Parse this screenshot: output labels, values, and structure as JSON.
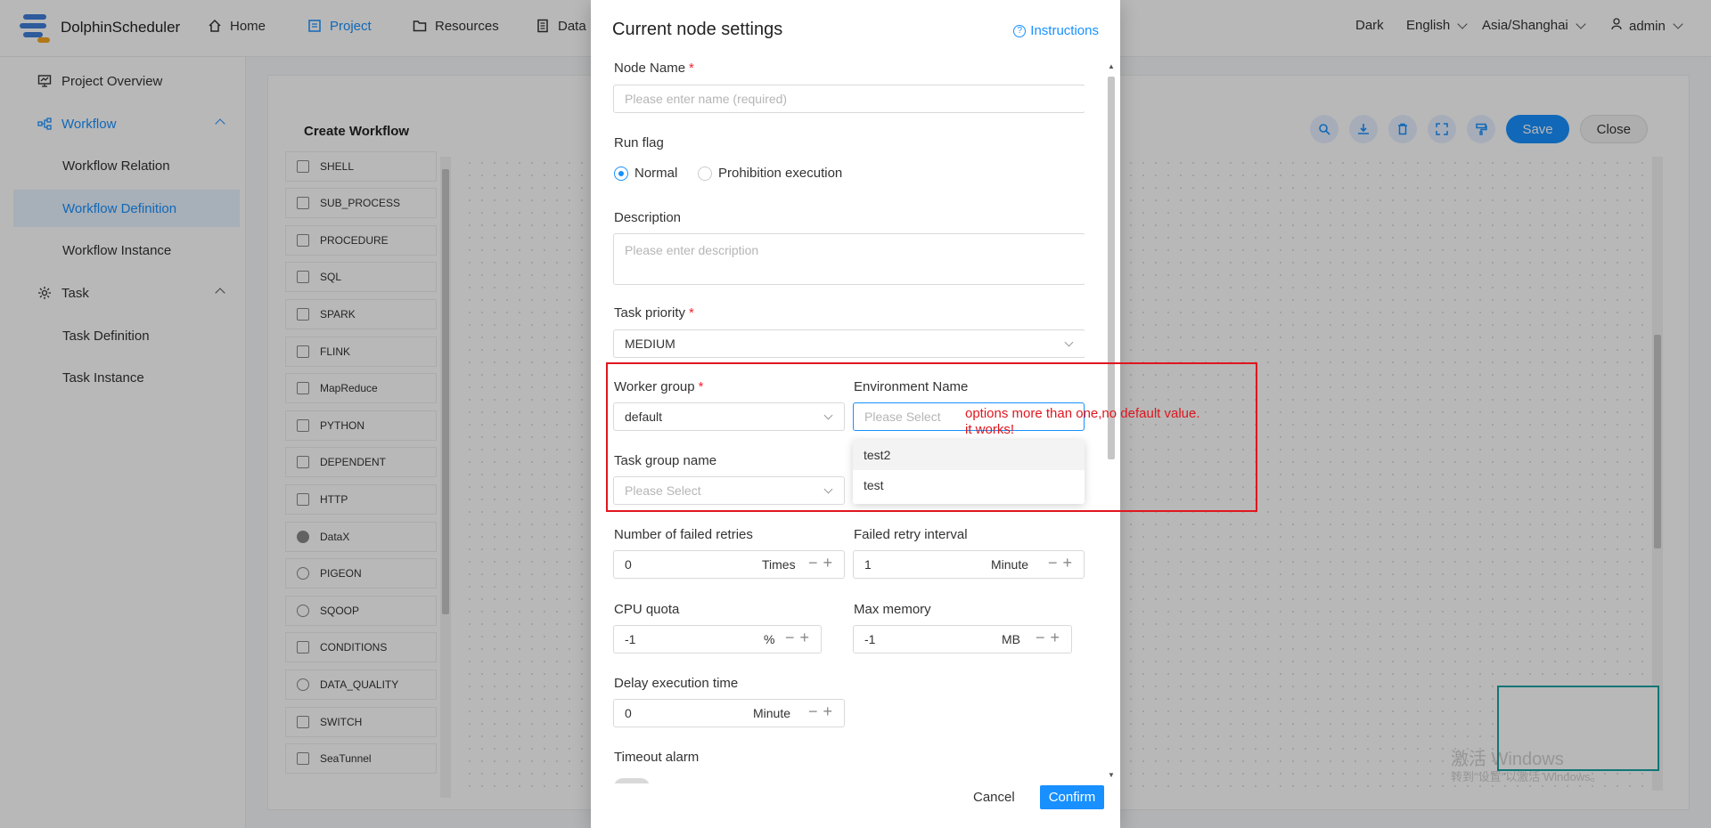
{
  "app": {
    "brand": "DolphinScheduler",
    "nav": [
      {
        "label": "Home",
        "icon": "home-icon"
      },
      {
        "label": "Project",
        "icon": "project-icon"
      },
      {
        "label": "Resources",
        "icon": "folder-icon"
      },
      {
        "label": "Data",
        "icon": "datasource-icon"
      }
    ],
    "theme_label": "Dark",
    "language_label": "English",
    "timezone_label": "Asia/Shanghai",
    "user_label": "admin"
  },
  "sidebar": {
    "items": [
      {
        "label": "Project Overview"
      },
      {
        "label": "Workflow"
      },
      {
        "label": "Workflow Relation"
      },
      {
        "label": "Workflow Definition"
      },
      {
        "label": "Workflow Instance"
      },
      {
        "label": "Task"
      },
      {
        "label": "Task Definition"
      },
      {
        "label": "Task Instance"
      }
    ]
  },
  "workflow": {
    "title": "Create Workflow",
    "save_label": "Save",
    "close_label": "Close",
    "tasks": [
      "SHELL",
      "SUB_PROCESS",
      "PROCEDURE",
      "SQL",
      "SPARK",
      "FLINK",
      "MapReduce",
      "PYTHON",
      "DEPENDENT",
      "HTTP",
      "DataX",
      "PIGEON",
      "SQOOP",
      "CONDITIONS",
      "DATA_QUALITY",
      "SWITCH",
      "SeaTunnel"
    ]
  },
  "modal": {
    "title": "Current node settings",
    "instructions_label": "Instructions",
    "node_name_label": "Node Name",
    "node_name_placeholder": "Please enter name (required)",
    "run_flag_label": "Run flag",
    "run_flag_normal": "Normal",
    "run_flag_prohibition": "Prohibition execution",
    "description_label": "Description",
    "description_placeholder": "Please enter description",
    "priority_label": "Task priority",
    "priority_value": "MEDIUM",
    "worker_group_label": "Worker group",
    "worker_group_value": "default",
    "environment_label": "Environment Name",
    "environment_placeholder": "Please Select",
    "task_group_label": "Task group name",
    "task_group_placeholder": "Please Select",
    "retries_label": "Number of failed retries",
    "retries_value": "0",
    "retries_unit": "Times",
    "retry_interval_label": "Failed retry interval",
    "retry_interval_value": "1",
    "retry_interval_unit": "Minute",
    "cpu_label": "CPU quota",
    "cpu_value": "-1",
    "cpu_unit": "%",
    "memory_label": "Max memory",
    "memory_value": "-1",
    "memory_unit": "MB",
    "delay_label": "Delay execution time",
    "delay_value": "0",
    "delay_unit": "Minute",
    "timeout_label": "Timeout alarm",
    "cancel_label": "Cancel",
    "confirm_label": "Confirm",
    "required_mark": "*"
  },
  "environment_dropdown": {
    "options": [
      "test2",
      "test"
    ]
  },
  "annotation": {
    "line1": "options more than one,no default value.",
    "line2": "it works!"
  },
  "watermark": {
    "line1": "激活 Windows",
    "line2": "转到\"设置\"以激活 Windows。"
  },
  "colors": {
    "accent": "#1890ff",
    "annotation_red": "#e0161e",
    "minimap_border": "#1aa3a3"
  }
}
